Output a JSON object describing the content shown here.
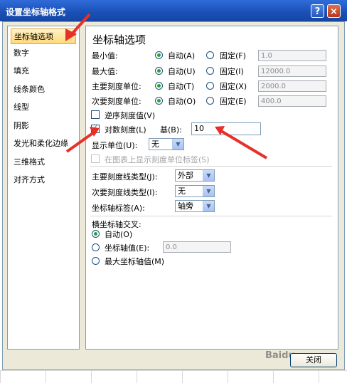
{
  "window": {
    "title": "设置坐标轴格式",
    "help_icon": "?",
    "close_icon": "×"
  },
  "sidebar": {
    "items": [
      {
        "label": "坐标轴选项",
        "selected": true
      },
      {
        "label": "数字"
      },
      {
        "label": "填充"
      },
      {
        "label": "线条颜色"
      },
      {
        "label": "线型"
      },
      {
        "label": "阴影"
      },
      {
        "label": "发光和柔化边缘"
      },
      {
        "label": "三维格式"
      },
      {
        "label": "对齐方式"
      }
    ]
  },
  "panel": {
    "heading": "坐标轴选项",
    "rows": [
      {
        "label": "最小值:",
        "auto": "自动(A)",
        "fixed": "固定(F)",
        "value": "1.0"
      },
      {
        "label": "最大值:",
        "auto": "自动(U)",
        "fixed": "固定(I)",
        "value": "12000.0"
      },
      {
        "label": "主要刻度单位:",
        "auto": "自动(T)",
        "fixed": "固定(X)",
        "value": "2000.0"
      },
      {
        "label": "次要刻度单位:",
        "auto": "自动(O)",
        "fixed": "固定(E)",
        "value": "400.0"
      }
    ],
    "reverse_label": "逆序刻度值(V)",
    "log_label": "对数刻度(L)",
    "base_label": "基(B):",
    "base_value": "10",
    "display_unit_label": "显示单位(U):",
    "display_unit_value": "无",
    "show_unit_label": "在图表上显示刻度单位标签(S)",
    "major_tick_label": "主要刻度线类型(J):",
    "major_tick_value": "外部",
    "minor_tick_label": "次要刻度线类型(I):",
    "minor_tick_value": "无",
    "axis_labels_label": "坐标轴标签(A):",
    "axis_labels_value": "轴旁",
    "cross_heading": "横坐标轴交叉:",
    "cross_auto": "自动(O)",
    "cross_value_label": "坐标轴值(E):",
    "cross_value": "0.0",
    "cross_max": "最大坐标轴值(M)"
  },
  "footer": {
    "close_label": "关闭",
    "watermark": "Baidu"
  }
}
